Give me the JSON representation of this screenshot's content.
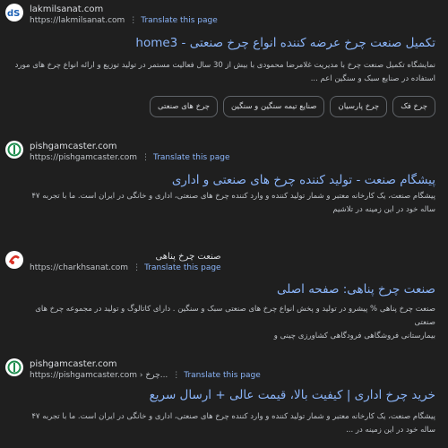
{
  "results": [
    {
      "site_name": "lakmilsanat.com",
      "url": "https://lakmilsanat.com",
      "translate": "Translate this page",
      "title": "تکمیل صنعت چرخ عرضه کننده انواع چرخ صنعتی - home3",
      "snippet_lines": [
        "نمایشگاه تکمیل صنعت چرخ با مدیریت غلامرضا محمودی با بیش از 30 سال فعالیت مستمر در تولید توزیع و ارائه انواع چرخ های مورد",
        "استفاده در صنایع سبک و سنگین اعم ..."
      ],
      "chips": [
        "چرخ فک",
        "چرخ پارسیان",
        "صنایع تیمه سنگین و سنگین",
        "چرخ های صنعتی"
      ]
    },
    {
      "site_name": "pishgamcaster.com",
      "url": "https://pishgamcaster.com",
      "translate": "Translate this page",
      "title": "پیشگام صنعت - تولید کننده چرخ های صنعتی و اداری",
      "snippet_lines": [
        "پیشگام صنعت، یک کارخانه معتبر و شمار تولید کننده و وارد کننده چرخ های صنعتی، اداری و خانگی در ایران است. ما با تجربه ۴۷",
        "ساله خود در این زمینه در تلاشیم"
      ]
    },
    {
      "site_name": "صنعت چرخ پناهی",
      "url": "https://charkhsanat.com",
      "translate": "Translate this page",
      "title": "صنعت چرخ پناهی: صفحه اصلی",
      "snippet_lines": [
        "صنعت چرخ پناهی % پیشرو در تولید و پخش انواع چرخ های صنعتی سبک و سنگین . دارای کاتالوگ و تولید در مجموعه چرخ های صنعتی",
        "بیمارستانی فروشگاهی فرودگاهی کشاورزی چینی و"
      ]
    },
    {
      "site_name": "pishgamcaster.com",
      "url": "https://pishgamcaster.com › چرخ...",
      "translate": "Translate this page",
      "title": "خرید چرخ اداری | کیفیت بالا، قیمت عالی + ارسال سریع",
      "snippet_lines": [
        "پیشگام صنعت، یک کارخانه معتبر و شمار تولید کننده و وارد کننده چرخ های صنعتی، اداری و خانگی در ایران است. ما با تجربه ۴۷",
        "ساله خود در این زمینه در ..."
      ]
    }
  ],
  "icons": {
    "more": "vertical-dots-icon",
    "logo1": "ds-logo-icon",
    "logo2": "pishgam-logo-icon",
    "logo3": "charkh-logo-icon"
  },
  "colors": {
    "background": "#1f1f1f",
    "link": "#8ab4f8",
    "text": "#bdc1c6"
  }
}
